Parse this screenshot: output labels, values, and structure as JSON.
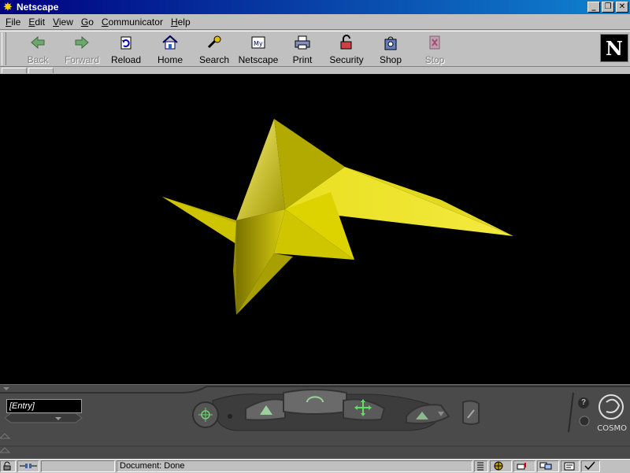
{
  "window": {
    "title": "Netscape",
    "controls": {
      "minimize": "_",
      "maximize": "❐",
      "close": "✕"
    }
  },
  "menu": {
    "items": [
      {
        "label": "File",
        "accel": "F",
        "rest": "ile"
      },
      {
        "label": "Edit",
        "accel": "E",
        "rest": "dit"
      },
      {
        "label": "View",
        "accel": "V",
        "rest": "iew"
      },
      {
        "label": "Go",
        "accel": "G",
        "rest": "o"
      },
      {
        "label": "Communicator",
        "accel": "C",
        "rest": "ommunicator"
      },
      {
        "label": "Help",
        "accel": "H",
        "rest": "elp"
      }
    ]
  },
  "toolbar": {
    "buttons": [
      {
        "label": "Back",
        "icon": "back-arrow-icon",
        "enabled": false
      },
      {
        "label": "Forward",
        "icon": "forward-arrow-icon",
        "enabled": false
      },
      {
        "label": "Reload",
        "icon": "reload-icon",
        "enabled": true
      },
      {
        "label": "Home",
        "icon": "home-icon",
        "enabled": true
      },
      {
        "label": "Search",
        "icon": "search-icon",
        "enabled": true
      },
      {
        "label": "Netscape",
        "icon": "my-netscape-icon",
        "enabled": true
      },
      {
        "label": "Print",
        "icon": "printer-icon",
        "enabled": true
      },
      {
        "label": "Security",
        "icon": "padlock-icon",
        "enabled": true
      },
      {
        "label": "Shop",
        "icon": "shopping-bag-icon",
        "enabled": true
      },
      {
        "label": "Stop",
        "icon": "stop-icon",
        "enabled": false
      }
    ],
    "logo_letter": "N"
  },
  "scene": {
    "background": "#000000",
    "object_color": "#c8c000"
  },
  "cosmo_controls": {
    "viewpoint_entry": "[Entry]",
    "brand": "COSMO",
    "help_label": "?"
  },
  "status": {
    "text": "Document: Done"
  }
}
